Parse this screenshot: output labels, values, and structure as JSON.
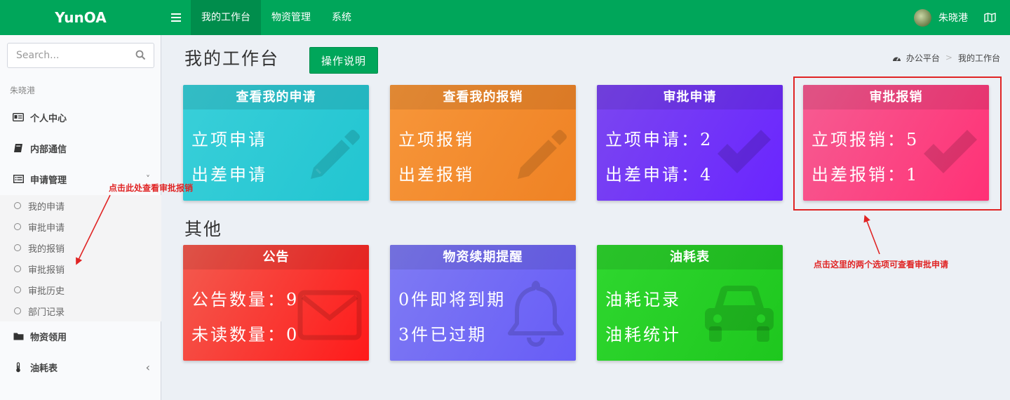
{
  "header": {
    "logo": "YunOA",
    "menu_icon": "hamburger-icon",
    "nav": [
      {
        "label": "我的工作台",
        "active": true
      },
      {
        "label": "物资管理",
        "active": false
      },
      {
        "label": "系统",
        "active": false
      }
    ],
    "username": "朱晓港",
    "map_icon": "map-icon",
    "bar_color": "#00a65a"
  },
  "sidebar": {
    "search_placeholder": "Search...",
    "user_label": "朱晓港",
    "items": [
      {
        "label": "个人中心",
        "icon": "id-card-icon"
      },
      {
        "label": "内部通信",
        "icon": "book-icon"
      },
      {
        "label": "申请管理",
        "icon": "list-icon",
        "caret": "˅"
      },
      {
        "label": "物资领用",
        "icon": "folder-icon"
      },
      {
        "label": "油耗表",
        "icon": "thermometer-icon",
        "caret": "‹"
      }
    ],
    "sub_items": [
      "我的申请",
      "审批申请",
      "我的报销",
      "审批报销",
      "审批历史",
      "部门记录"
    ]
  },
  "main": {
    "title": "我的工作台",
    "help_button": "操作说明",
    "breadcrumb": [
      "办公平台",
      "我的工作台"
    ],
    "breadcrumb_sep": ">",
    "cards": [
      {
        "title": "查看我的申请",
        "line1": "立项申请",
        "line2": "出差申请",
        "icon": "pencil-icon",
        "color": "#22c5d1"
      },
      {
        "title": "查看我的报销",
        "line1": "立项报销",
        "line2": "出差报销",
        "icon": "pencil-icon",
        "color": "#ef8224"
      },
      {
        "title": "审批申请",
        "line1": "立项申请：2",
        "line2": "出差申请：4",
        "icon": "check-icon",
        "color": "#6a25ff"
      },
      {
        "title": "审批报销",
        "line1": "立项报销：5",
        "line2": "出差报销：1",
        "icon": "check-icon",
        "color": "#ff3176"
      }
    ],
    "other_title": "其他",
    "other_cards": [
      {
        "title": "公告",
        "line1": "公告数量：9",
        "line2": "未读数量：0",
        "icon": "envelope-icon",
        "color": "#ff1a1a"
      },
      {
        "title": "物资续期提醒",
        "line1": "0件即将到期",
        "line2": "3件已过期",
        "icon": "bell-icon",
        "color": "#675cf7"
      },
      {
        "title": "油耗表",
        "line1": "油耗记录",
        "line2": "油耗统计",
        "icon": "car-icon",
        "color": "#1ec71e"
      }
    ]
  },
  "annotations": {
    "left": "点击此处查看审批报销",
    "right": "点击这里的两个选项可查看审批申请",
    "color": "#e02424"
  }
}
